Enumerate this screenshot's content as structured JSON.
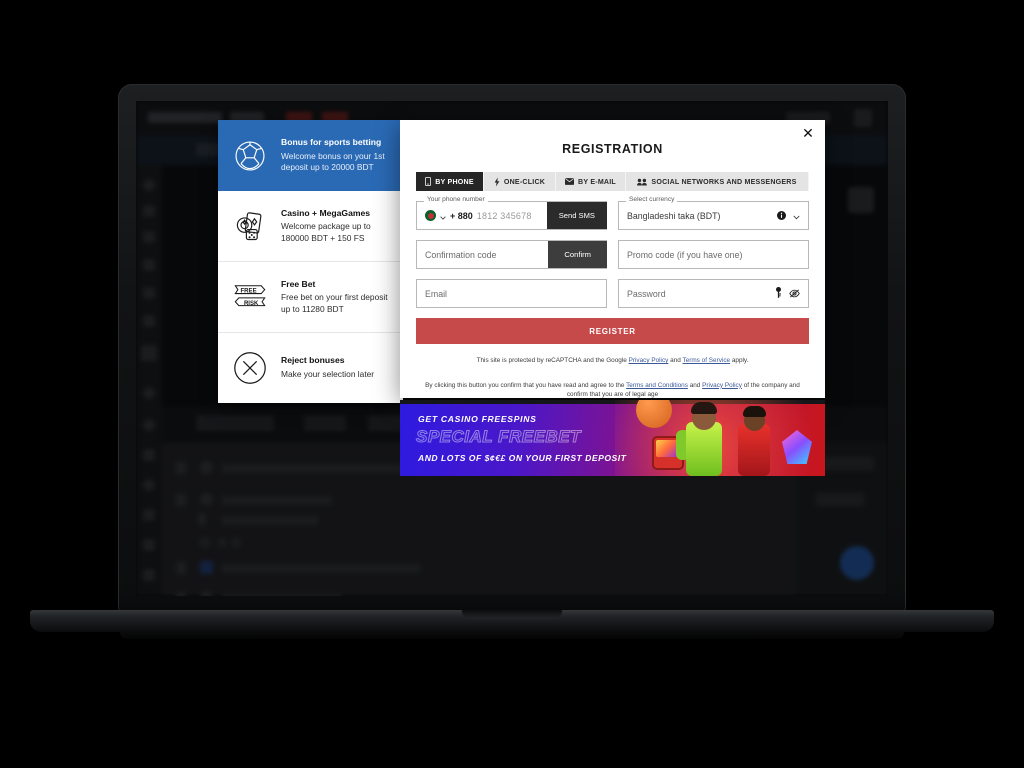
{
  "bonus_panel": {
    "items": [
      {
        "icon": "soccer-ball-icon",
        "title": "Bonus for sports betting",
        "description": "Welcome bonus on your 1st deposit up to 20000 BDT",
        "selected": true
      },
      {
        "icon": "casino-cards-chip-icon",
        "title": "Casino + MegaGames",
        "description": "Welcome package up to 180000 BDT + 150 FS",
        "selected": false
      },
      {
        "icon": "free-risk-ticket-icon",
        "title": "Free Bet",
        "description": "Free bet on your first deposit up to 11280 BDT",
        "selected": false
      },
      {
        "icon": "reject-cross-circle-icon",
        "title": "Reject bonuses",
        "description": "Make your selection later",
        "selected": false
      }
    ],
    "ticket_top_label": "FREE",
    "ticket_bottom_label": "RISK"
  },
  "modal": {
    "title": "REGISTRATION",
    "close_label": "✕",
    "tabs": [
      {
        "label": "BY PHONE",
        "icon": "mobile-phone-icon",
        "active": true
      },
      {
        "label": "ONE-CLICK",
        "icon": "lightning-bolt-icon",
        "active": false
      },
      {
        "label": "BY E-MAIL",
        "icon": "envelope-icon",
        "active": false
      },
      {
        "label": "SOCIAL NETWORKS AND MESSENGERS",
        "icon": "social-group-icon",
        "active": false
      }
    ],
    "phone_field": {
      "legend": "Your phone number",
      "flag": "bangladesh-flag-icon",
      "country_code": "+ 880",
      "placeholder": "1812 345678",
      "value": "",
      "button_label": "Send SMS"
    },
    "currency_field": {
      "legend": "Select currency",
      "value": "Bangladeshi taka (BDT)",
      "info_icon": "info-icon",
      "chevron_icon": "chevron-down-icon"
    },
    "confirmation_field": {
      "placeholder": "Confirmation code",
      "value": "",
      "button_label": "Confirm"
    },
    "promo_field": {
      "placeholder": "Promo code (if you have one)",
      "value": ""
    },
    "email_field": {
      "placeholder": "Email",
      "value": ""
    },
    "password_field": {
      "placeholder": "Password",
      "value": "",
      "generate_icon": "key-icon",
      "visibility_icon": "eye-off-icon"
    },
    "register_button": "REGISTER",
    "recaptcha_notice": {
      "before": "This site is protected by reCAPTCHA and the Google ",
      "link1": "Privacy Policy",
      "middle": " and ",
      "link2": "Terms of Service",
      "after": " apply."
    },
    "terms_notice": {
      "before": "By clicking this button you confirm that you have read and agree to the ",
      "link1": "Terms and Conditions",
      "middle": " and ",
      "link2": "Privacy Policy",
      "after": " of the company and confirm that you are of legal age"
    }
  },
  "promo_banner": {
    "line1": "GET CASINO FREESPINS",
    "line2": "SPECIAL FREEBET",
    "line3": "AND LOTS OF $¢€£ ON YOUR FIRST DEPOSIT"
  },
  "colors": {
    "accent_blue": "#2a6ab5",
    "register_red": "#c74a4a",
    "tab_active": "#262626",
    "link_blue": "#3b5998"
  }
}
